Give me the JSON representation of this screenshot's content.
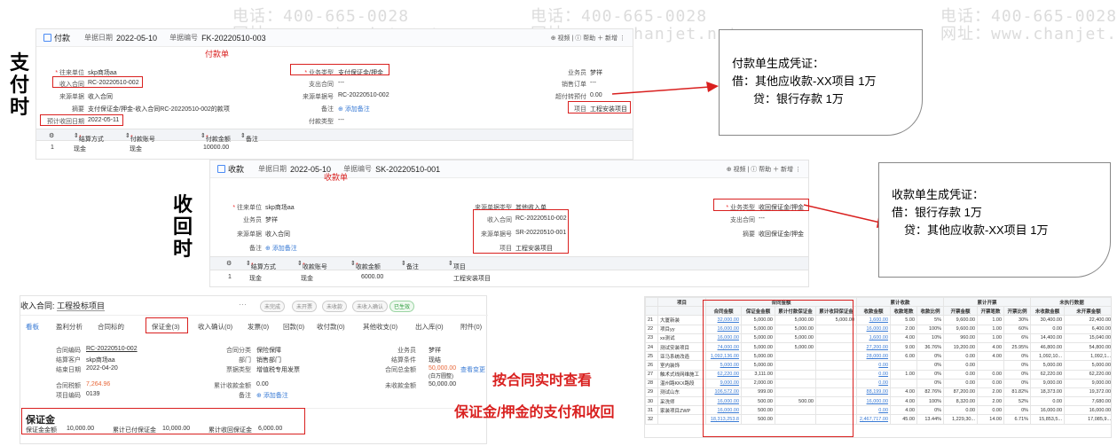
{
  "section_labels": {
    "pay": [
      "支",
      "付",
      "时"
    ],
    "recv": [
      "收",
      "回",
      "时"
    ]
  },
  "watermark": {
    "phone": "电话：400-665-0028",
    "site": "网址：www.chanjet.net"
  },
  "payment": {
    "title": "付款",
    "date_label": "单据日期",
    "date": "2022-05-10",
    "no_label": "单据编号",
    "no": "FK-20220510-003",
    "tag": "付款单",
    "right_actions": "⊕ 视频 | ⓘ 帮助 ＋ 新增 ⋮",
    "f1_label": "往来单位",
    "f1_value": "skp商场aa",
    "f2_label": "收入合同",
    "f2_value": "RC-20220510-002",
    "f3_label": "来源单据",
    "f3_value": "收入合同",
    "f4_label": "摘要",
    "f4_value": "支付保证金/押金-收入合同RC-20220510-002的款项",
    "f5_label": "预计收回日期",
    "f5_value": "2022-05-11",
    "m1_label": "业务类型",
    "m1_value": "支付保证金/押金",
    "m2_label": "支出合同",
    "m2_value": "---",
    "m3_label": "来源单据号",
    "m3_value": "RC-20220510-002",
    "m4_label": "备注",
    "m4_value": "添加备注",
    "m5_label": "付款类型",
    "m5_value": "---",
    "r1_label": "业务员",
    "r1_value": "梦祥",
    "r2_label": "销售订单",
    "r2_value": "---",
    "r3_label": "超付转预付",
    "r3_value": "0.00",
    "r4_label": "项目",
    "r4_value": "工程安装项目",
    "cols": [
      "",
      "结算方式",
      "付款账号",
      "付款金额",
      "备注"
    ],
    "row": [
      "1",
      "现金",
      "现金",
      "10000.00",
      ""
    ]
  },
  "callout_pay": {
    "line1": "付款单生成凭证：",
    "line2": "借：其他应收款-XX项目  1万",
    "line3": "贷：银行存款   1万"
  },
  "receipt": {
    "title": "收款",
    "date_label": "单据日期",
    "date": "2022-05-10",
    "no_label": "单据编号",
    "no": "SK-20220510-001",
    "tag": "收款单",
    "right_actions": "⊕ 视频 | ⓘ 帮助 ＋ 新增 ⋮",
    "f1_label": "往来单位",
    "f1_value": "skp商场aa",
    "f2_label": "业务员",
    "f2_value": "梦祥",
    "f3_label": "来源单据",
    "f3_value": "收入合同",
    "f4_label": "备注",
    "f4_value": "添加备注",
    "m1_label": "来源单据类型",
    "m1_value": "其他收入单",
    "m2_label": "收入合同",
    "m2_value": "RC-20220510-002",
    "m3_label": "来源单据号",
    "m3_value": "SR-20220510-001",
    "m4_label": "项目",
    "m4_value": "工程安装项目",
    "r1_label": "业务类型",
    "r1_value": "收回保证金/押金",
    "r2_label": "支出合同",
    "r2_value": "---",
    "r3_label": "摘要",
    "r3_value": "收回保证金/押金",
    "cols": [
      "",
      "结算方式",
      "收款账号",
      "收款金额",
      "备注",
      "项目"
    ],
    "row": [
      "1",
      "现金",
      "现金",
      "6000.00",
      "",
      "工程安装项目"
    ]
  },
  "callout_recv": {
    "line1": "收款单生成凭证：",
    "line2": "借：银行存款  1万",
    "line3": "贷：其他应收款-XX项目 1万"
  },
  "contract": {
    "title_label": "收入合同:",
    "title_value": "工程投标项目",
    "pills": [
      "未完成",
      "未开票",
      "未收款",
      "未收入确认",
      "已生效"
    ],
    "tabs": [
      "看板",
      "盈利分析",
      "合同标的",
      "保证金(3)",
      "收入确认(0)",
      "发票(0)",
      "回款(0)",
      "收付款(0)",
      "其他收支(0)",
      "出入库(0)",
      "附件(0)"
    ],
    "a_labels": [
      "合同编码",
      "结算客户",
      "结束日期",
      "",
      "合同税额",
      "项目编码"
    ],
    "a_values": [
      "RC-20220510-002",
      "skp商场aa",
      "2022-04-20",
      "",
      "7,264.96",
      "0139"
    ],
    "b_labels": [
      "合同分类",
      "部门",
      "票据类型",
      "",
      "累计收款金额",
      "备注"
    ],
    "b_values": [
      "保险保障",
      "销售部门",
      "增值税专用发票",
      "",
      "0.00",
      "添加备注"
    ],
    "c_labels": [
      "业务员",
      "结算条件",
      "合同总金额",
      "",
      "未收款金额"
    ],
    "c_values": [
      "梦祥",
      "现结",
      "50,000.00",
      "",
      "50,000.00"
    ],
    "c_extra": "(白万圆整)",
    "c_link": "查看变更",
    "deposit_title": "保证金",
    "deposit_items": [
      "保证金金额",
      "10,000.00",
      "累计已付保证金",
      "10,000.00",
      "累计收回保证金",
      "6,000.00"
    ]
  },
  "caption": {
    "line1": "按合同实时查看",
    "line2": "保证金/押金的支付和收回"
  },
  "report": {
    "group_headers": [
      "",
      "项目",
      "合同金额",
      "",
      "",
      "",
      "累计收款",
      "",
      "",
      "累计开票",
      "",
      "",
      "未执行数据",
      ""
    ],
    "headers": [
      "",
      "",
      "合同金额",
      "保证金金额",
      "累计付款保证金",
      "累计收回保证金",
      "收款金额",
      "收款笔数",
      "收款比例",
      "开票金额",
      "开票笔数",
      "开票比例",
      "未收款金额",
      "未开票金额"
    ],
    "rows": [
      [
        "21",
        "大厦新装",
        "32,000.00",
        "5,000.00",
        "5,000.00",
        "5,000.00",
        "1,600.00",
        "5.00",
        "5%",
        "9,600.00",
        "1.00",
        "30%",
        "30,400.00",
        "22,400.00"
      ],
      [
        "22",
        "项目yy",
        "16,000.00",
        "5,000.00",
        "5,000.00",
        "",
        "16,000.00",
        "2.00",
        "100%",
        "9,600.00",
        "1.00",
        "60%",
        "0.00",
        "6,400.00"
      ],
      [
        "23",
        "xx测试",
        "16,000.00",
        "5,000.00",
        "5,000.00",
        "",
        "1,600.00",
        "4.00",
        "10%",
        "960.00",
        "1.00",
        "6%",
        "14,400.00",
        "15,040.00"
      ],
      [
        "24",
        "测试安装项目",
        "74,000.00",
        "5,000.00",
        "5,000.00",
        "",
        "27,200.00",
        "9.00",
        "36.76%",
        "19,200.00",
        "4.00",
        "25.95%",
        "46,800.00",
        "54,800.00"
      ],
      [
        "25",
        "亚马系统改造",
        "1,092,136.00",
        "5,000.00",
        "",
        "",
        "28,000.00",
        "6.00",
        "0%",
        "0.00",
        "4.00",
        "0%",
        "1,092,10...",
        "1,092,1..."
      ],
      [
        "26",
        "室内装饰",
        "5,000.00",
        "5,000.00",
        "",
        "",
        "0.00",
        "",
        "0%",
        "0.00",
        "",
        "0%",
        "5,000.00",
        "5,000.00"
      ],
      [
        "27",
        "触术式线网维施工",
        "62,220.00",
        "3,111.00",
        "",
        "",
        "0.00",
        "1.00",
        "0%",
        "0.00",
        "0.00",
        "0%",
        "62,220.00",
        "62,220.00"
      ],
      [
        "28",
        "温州路KKX路段",
        "9,000.00",
        "2,000.00",
        "",
        "",
        "0.00",
        "",
        "0%",
        "0.00",
        "0.00",
        "0%",
        "9,000.00",
        "9,000.00"
      ],
      [
        "29",
        "测试山东",
        "106,572.00",
        "999.00",
        "",
        "",
        "88,199.00",
        "4.00",
        "82.76%",
        "87,200.00",
        "2.00",
        "81.82%",
        "18,373.00",
        "19,372.00"
      ],
      [
        "30",
        "采洗师",
        "16,000.00",
        "500.00",
        "500.00",
        "",
        "16,000.00",
        "4.00",
        "100%",
        "8,320.00",
        "2.00",
        "52%",
        "0.00",
        "7,680.00"
      ],
      [
        "31",
        "家装项目ZWP",
        "16,000.00",
        "500.00",
        "",
        "",
        "0.00",
        "4.00",
        "0%",
        "0.00",
        "0.00",
        "0%",
        "16,000.00",
        "16,000.00"
      ],
      [
        "32",
        "",
        "18,313,253.8",
        "500.00",
        "",
        "",
        "2,467,717.00",
        "45.00",
        "13.44%",
        "1,229,30...",
        "14.00",
        "6.71%",
        "15,853,5...",
        "17,085,9..."
      ]
    ]
  }
}
